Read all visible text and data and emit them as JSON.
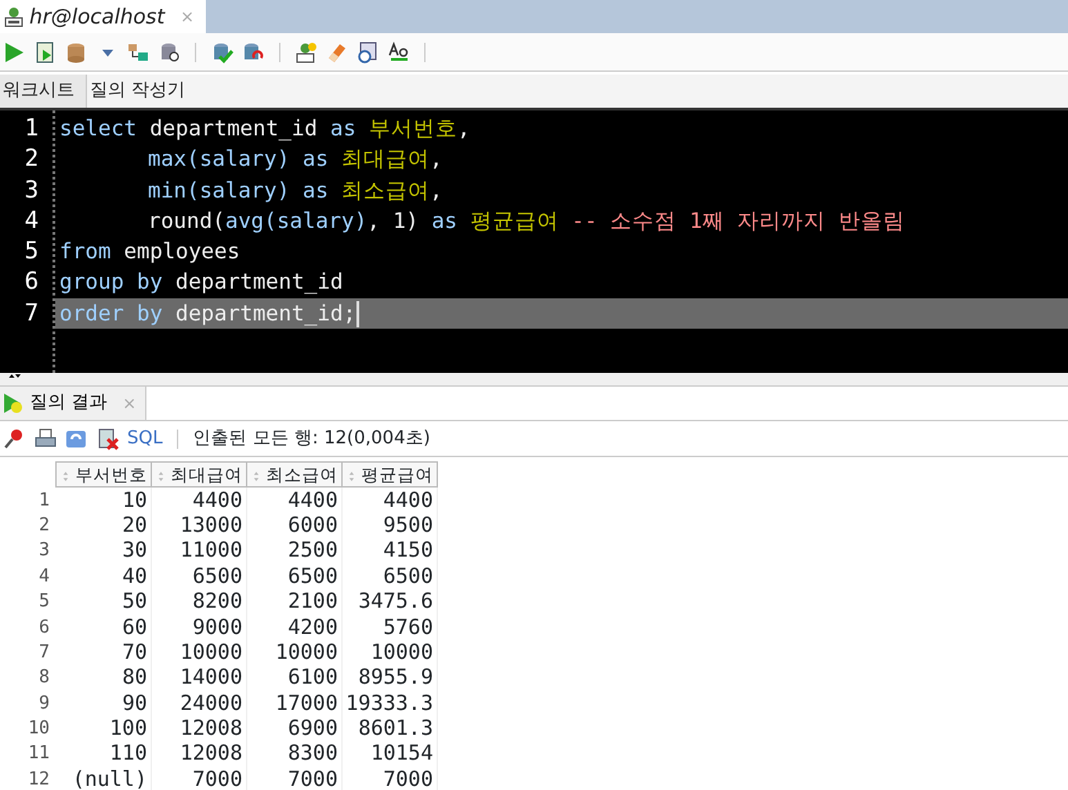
{
  "document_tab": {
    "title": "hr@localhost",
    "close": "×"
  },
  "editor_tabs": [
    {
      "label": "워크시트",
      "selected": true
    },
    {
      "label": "질의 작성기",
      "selected": false
    }
  ],
  "editor": {
    "lines": [
      {
        "number": "1",
        "indent": false,
        "selected": false,
        "tokens": [
          {
            "t": "select",
            "kind": "kw"
          },
          {
            "t": " department_id ",
            "kind": "id"
          },
          {
            "t": "as",
            "kind": "kw"
          },
          {
            "t": " 부서번호",
            "kind": "alias"
          },
          {
            "t": ",",
            "kind": "id"
          }
        ]
      },
      {
        "number": "2",
        "indent": true,
        "selected": false,
        "tokens": [
          {
            "t": "max(salary) ",
            "kind": "kw"
          },
          {
            "t": "as",
            "kind": "kw"
          },
          {
            "t": " 최대급여",
            "kind": "alias"
          },
          {
            "t": ",",
            "kind": "id"
          }
        ]
      },
      {
        "number": "3",
        "indent": true,
        "selected": false,
        "tokens": [
          {
            "t": "min(salary) ",
            "kind": "kw"
          },
          {
            "t": "as",
            "kind": "kw"
          },
          {
            "t": " 최소급여",
            "kind": "alias"
          },
          {
            "t": ",",
            "kind": "id"
          }
        ]
      },
      {
        "number": "4",
        "indent": true,
        "selected": false,
        "tokens": [
          {
            "t": "round(",
            "kind": "id"
          },
          {
            "t": "avg(salary)",
            "kind": "kw"
          },
          {
            "t": ", 1) ",
            "kind": "id"
          },
          {
            "t": "as",
            "kind": "kw"
          },
          {
            "t": " 평균급여 ",
            "kind": "alias"
          },
          {
            "t": "-- 소수점 1째 자리까지 반올림",
            "kind": "comment"
          }
        ]
      },
      {
        "number": "5",
        "indent": false,
        "selected": false,
        "tokens": [
          {
            "t": "from",
            "kind": "kw"
          },
          {
            "t": " employees",
            "kind": "id"
          }
        ]
      },
      {
        "number": "6",
        "indent": false,
        "selected": false,
        "tokens": [
          {
            "t": "group by",
            "kind": "kw"
          },
          {
            "t": " department_id",
            "kind": "id"
          }
        ]
      },
      {
        "number": "7",
        "indent": false,
        "selected": true,
        "tokens": [
          {
            "t": "order by",
            "kind": "kw"
          },
          {
            "t": " department_id;",
            "kind": "id"
          }
        ]
      }
    ]
  },
  "results": {
    "tab": {
      "label": "질의 결과",
      "close": "×"
    },
    "sql_link": "SQL",
    "status": "인출된 모든 행: 12(0,004초)",
    "columns": [
      "부서번호",
      "최대급여",
      "최소급여",
      "평균급여"
    ],
    "rows": [
      {
        "number": "1",
        "cells": [
          "10",
          "4400",
          "4400",
          "4400"
        ]
      },
      {
        "number": "2",
        "cells": [
          "20",
          "13000",
          "6000",
          "9500"
        ]
      },
      {
        "number": "3",
        "cells": [
          "30",
          "11000",
          "2500",
          "4150"
        ]
      },
      {
        "number": "4",
        "cells": [
          "40",
          "6500",
          "6500",
          "6500"
        ]
      },
      {
        "number": "5",
        "cells": [
          "50",
          "8200",
          "2100",
          "3475.6"
        ]
      },
      {
        "number": "6",
        "cells": [
          "60",
          "9000",
          "4200",
          "5760"
        ]
      },
      {
        "number": "7",
        "cells": [
          "70",
          "10000",
          "10000",
          "10000"
        ]
      },
      {
        "number": "8",
        "cells": [
          "80",
          "14000",
          "6100",
          "8955.9"
        ]
      },
      {
        "number": "9",
        "cells": [
          "90",
          "24000",
          "17000",
          "19333.3"
        ]
      },
      {
        "number": "10",
        "cells": [
          "100",
          "12008",
          "6900",
          "8601.3"
        ]
      },
      {
        "number": "11",
        "cells": [
          "110",
          "12008",
          "8300",
          "10154"
        ]
      },
      {
        "number": "12",
        "cells": [
          "(null)",
          "7000",
          "7000",
          "7000"
        ]
      }
    ]
  }
}
